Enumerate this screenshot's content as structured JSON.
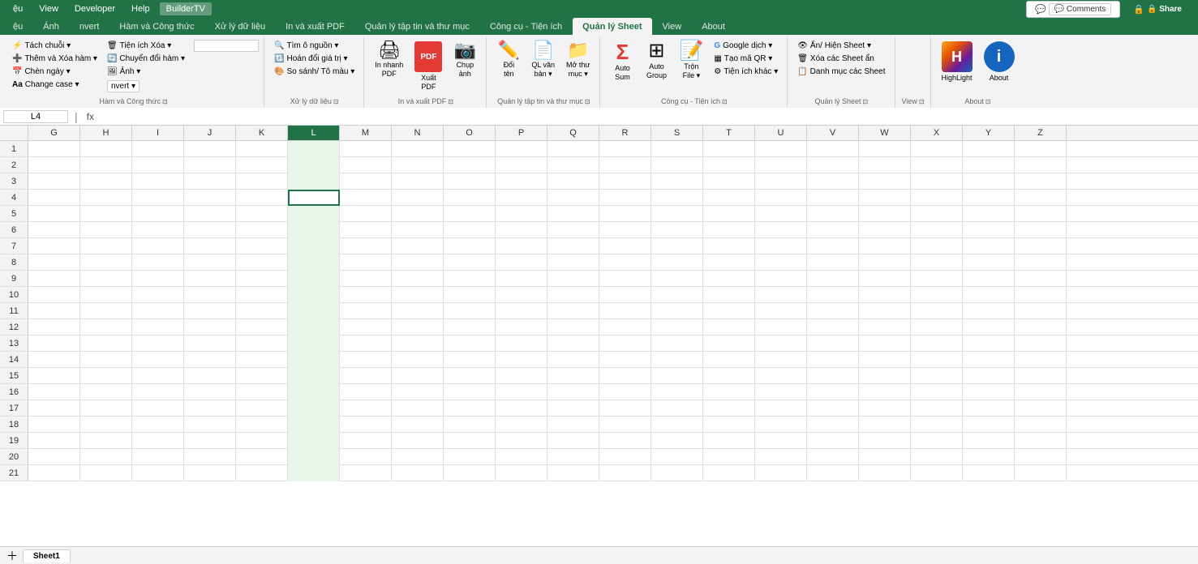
{
  "menuBar": {
    "items": [
      "ệu",
      "View",
      "Developer",
      "Help",
      "BuilderTV"
    ]
  },
  "tabs": {
    "items": [
      "ệu",
      "Ánh",
      "nvert",
      "Hàm và Công thức",
      "Xử lý dữ liệu",
      "In và xuất PDF",
      "Quản lý tập tin và thư mục",
      "Công cụ - Tiện ích",
      "Quản lý Sheet",
      "View",
      "About"
    ]
  },
  "ribbonTabs": [
    "ệu",
    "View",
    "Developer",
    "Help",
    "BuilderTV"
  ],
  "groups": {
    "hamCongThuc": {
      "label": "Hàm và Công thức",
      "buttons": [
        {
          "id": "tach-chuoi",
          "label": "Tách chuỗi",
          "icon": "⚡"
        },
        {
          "id": "them-xoa-ham",
          "label": "Thêm và Xóa hàm",
          "icon": "➕"
        },
        {
          "id": "chen-ngay",
          "label": "Chèn ngày",
          "icon": "📅"
        },
        {
          "id": "change-case",
          "label": "Aa Change case",
          "icon": "Aa"
        },
        {
          "id": "tien-ich-xoa",
          "label": "Tiện ích Xóa",
          "icon": "🗑"
        },
        {
          "id": "chuyen-doi-ham",
          "label": "Chuyển đổi hàm",
          "icon": "🔄"
        },
        {
          "id": "anh",
          "label": "Ảnh",
          "icon": "🖼"
        },
        {
          "id": "convert",
          "label": "nvert",
          "icon": "⊙"
        }
      ],
      "expand": "▼"
    },
    "xuLyDuLieu": {
      "label": "Xử lý dữ liệu",
      "buttons": [
        {
          "id": "tim-o-nguon",
          "label": "Tìm ô nguồn",
          "icon": "🔍"
        },
        {
          "id": "hoan-doi-gia-tri",
          "label": "Hoán đổi giá trị",
          "icon": "🔃"
        },
        {
          "id": "so-sanh-to-mau",
          "label": "So sánh/ Tô màu",
          "icon": "🎨"
        }
      ]
    },
    "inXuatPDF": {
      "label": "In và xuất PDF",
      "buttons": [
        {
          "id": "in-nhanh",
          "label": "In nhanh PDF",
          "icon": "🖨"
        },
        {
          "id": "xuat-pdf",
          "label": "Xuất PDF",
          "icon": "PDF"
        },
        {
          "id": "chup-anh",
          "label": "Chụp ảnh",
          "icon": "📷"
        }
      ]
    },
    "quanLyTapTin": {
      "label": "Quản lý tập tin và thư mục",
      "buttons": [
        {
          "id": "doi-ten",
          "label": "Đổi tên",
          "icon": "✏"
        },
        {
          "id": "ql-van-ban",
          "label": "QL văn bản",
          "icon": "📄"
        },
        {
          "id": "mo-thu-muc",
          "label": "Mở thư mục",
          "icon": "📁"
        }
      ]
    },
    "congCuTienIch": {
      "label": "Công cụ - Tiện ích",
      "buttons": [
        {
          "id": "auto-sum",
          "label": "Auto Sum",
          "icon": "Σ"
        },
        {
          "id": "auto-group",
          "label": "Auto Group",
          "icon": "⊞"
        },
        {
          "id": "tron-file",
          "label": "Trộn File",
          "icon": "⊟"
        },
        {
          "id": "google-dich",
          "label": "Google dịch",
          "icon": "G"
        },
        {
          "id": "tao-ma-qr",
          "label": "Tạo mã QR",
          "icon": "▦"
        },
        {
          "id": "tien-ich-khac",
          "label": "Tiện ích khác",
          "icon": "⚙"
        }
      ]
    },
    "quanLySheet": {
      "label": "Quản lý Sheet",
      "buttons": [
        {
          "id": "an-hien-sheet",
          "label": "Ẩn/ Hiện Sheet",
          "icon": "👁"
        },
        {
          "id": "xoa-cac-sheet-an",
          "label": "Xóa các Sheet ẩn",
          "icon": "🗑"
        },
        {
          "id": "danh-muc-cac-sheet",
          "label": "Danh mục các Sheet",
          "icon": "📋"
        }
      ]
    },
    "view": {
      "label": "View",
      "buttons": []
    },
    "about": {
      "label": "About",
      "buttons": [
        {
          "id": "highlight",
          "label": "HighLight",
          "icon": "H"
        },
        {
          "id": "about",
          "label": "About",
          "icon": "i"
        }
      ]
    }
  },
  "formulaBar": {
    "nameBox": "L4",
    "icon": "fx",
    "value": ""
  },
  "columns": [
    "G",
    "H",
    "I",
    "J",
    "K",
    "L",
    "M",
    "N",
    "O",
    "P",
    "Q",
    "R",
    "S",
    "T",
    "U",
    "V",
    "W",
    "X",
    "Y",
    "Z"
  ],
  "selectedCol": "L",
  "activeCell": {
    "row": 4,
    "col": "L"
  },
  "rows": [
    1,
    2,
    3,
    4,
    5,
    6,
    7,
    8,
    9,
    10,
    11,
    12,
    13,
    14,
    15,
    16,
    17,
    18,
    19,
    20,
    21
  ],
  "topRight": {
    "comments": "💬 Comments",
    "share": "🔒 Share"
  },
  "themes": {
    "primary": "#217346",
    "tabActive": "#f3f3f3"
  }
}
